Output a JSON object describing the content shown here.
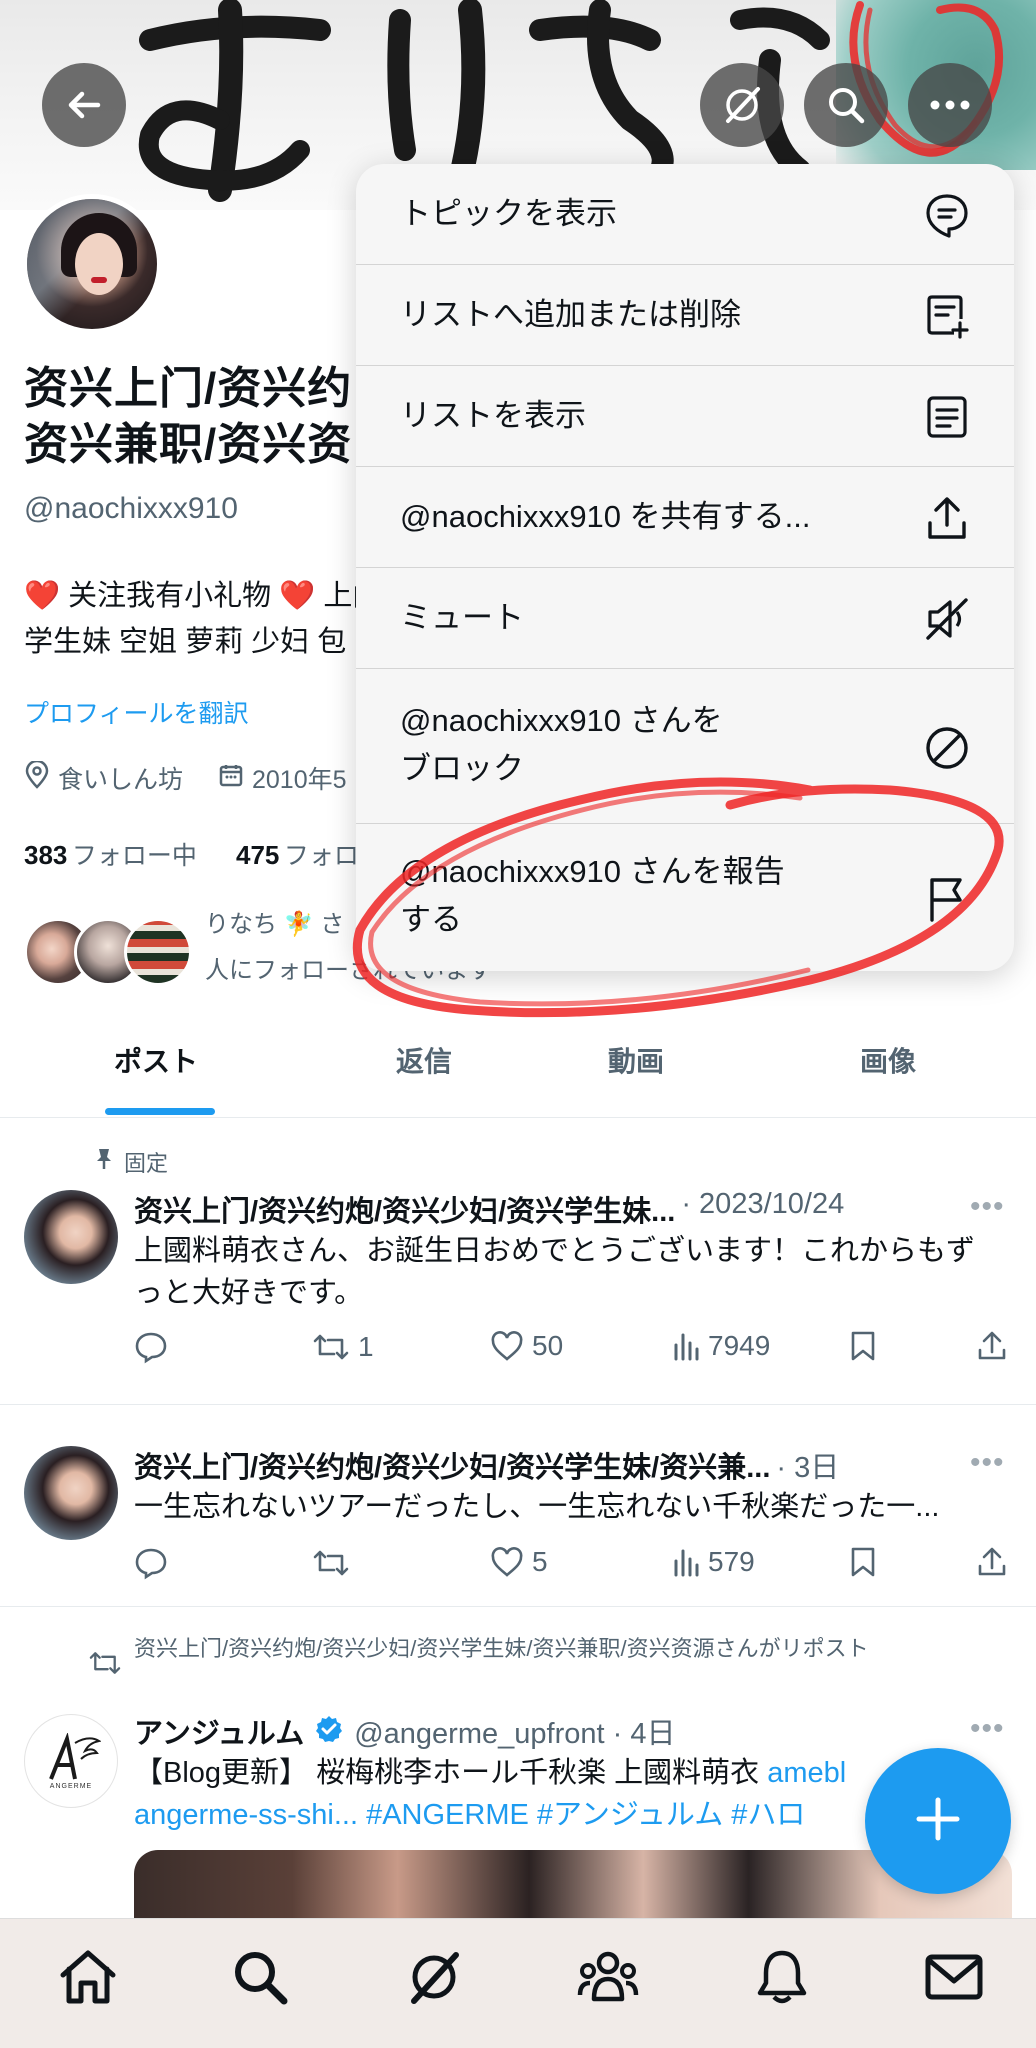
{
  "header": {
    "back_icon": "arrow-left-icon",
    "grok_icon": "grok-icon",
    "search_icon": "search-icon",
    "more_icon": "more-dots-icon"
  },
  "profile": {
    "name_line1": "资兴上门/资兴约",
    "name_line2": "资兴兼职/资兴资",
    "handle": "@naochixxx910",
    "bio_line1": "❤️ 关注我有小礼物 ❤️ 上门",
    "bio_line2": "学生妹 空姐 萝莉 少妇 包",
    "translate_link": "プロフィールを翻訳",
    "location": "食いしん坊",
    "joined": "2010年5",
    "following_count": "383",
    "following_label": "フォロー中",
    "followers_count": "475",
    "followers_label": "フォロ",
    "followed_by_line1": "りなち 🧚 さ",
    "followed_by_line2": "人にフォローされています"
  },
  "tabs": [
    {
      "label": "ポスト"
    },
    {
      "label": "返信"
    },
    {
      "label": "動画"
    },
    {
      "label": "画像"
    }
  ],
  "posts": [
    {
      "pinned_label": "固定",
      "name": "资兴上门/资兴约炮/资兴少妇/资兴学生妹...",
      "meta": "· 2023/10/24",
      "text": "上國料萌衣さん、お誕生日おめでとうございます！これからもずっと大好きです。",
      "replies": "",
      "reposts": "1",
      "likes": "50",
      "views": "7949"
    },
    {
      "name": "资兴上门/资兴约炮/资兴少妇/资兴学生妹/资兴兼...",
      "meta": "· 3日",
      "text": "一生忘れないツアーだったし、一生忘れない千秋楽だった一...",
      "replies": "",
      "reposts": "",
      "likes": "5",
      "views": "579"
    },
    {
      "repost_label": "资兴上门/资兴约炮/资兴少妇/资兴学生妹/资兴兼职/资兴资源さんがリポスト",
      "name": "アンジュルム",
      "handle_meta": "@angerme_upfront · 4日",
      "text_plain": "【Blog更新】 桜梅桃李ホール千秋楽 上國料萌衣 ",
      "text_link1": "amebl",
      "text_link2": "angerme-ss-shi... #ANGERME #アンジュルム #ハロ",
      "avatar_text": "ANGERME"
    }
  ],
  "menu": {
    "items": [
      {
        "label": "トピックを表示",
        "icon": "topic-icon"
      },
      {
        "label": "リストへ追加または削除",
        "icon": "list-add-icon"
      },
      {
        "label": "リストを表示",
        "icon": "list-icon"
      },
      {
        "label": "@naochixxx910 を共有する...",
        "icon": "share-icon"
      },
      {
        "label": "ミュート",
        "icon": "mute-icon"
      },
      {
        "label": "@naochixxx910 さんを\nブロック",
        "icon": "block-icon"
      },
      {
        "label": "@naochixxx910 さんを報告\nする",
        "icon": "flag-icon"
      }
    ]
  },
  "bottom_nav": [
    "home-icon",
    "search-icon",
    "grok-icon",
    "communities-icon",
    "notifications-icon",
    "messages-icon"
  ],
  "colors": {
    "accent": "#1d9bf0",
    "annotation": "#ee2424"
  }
}
